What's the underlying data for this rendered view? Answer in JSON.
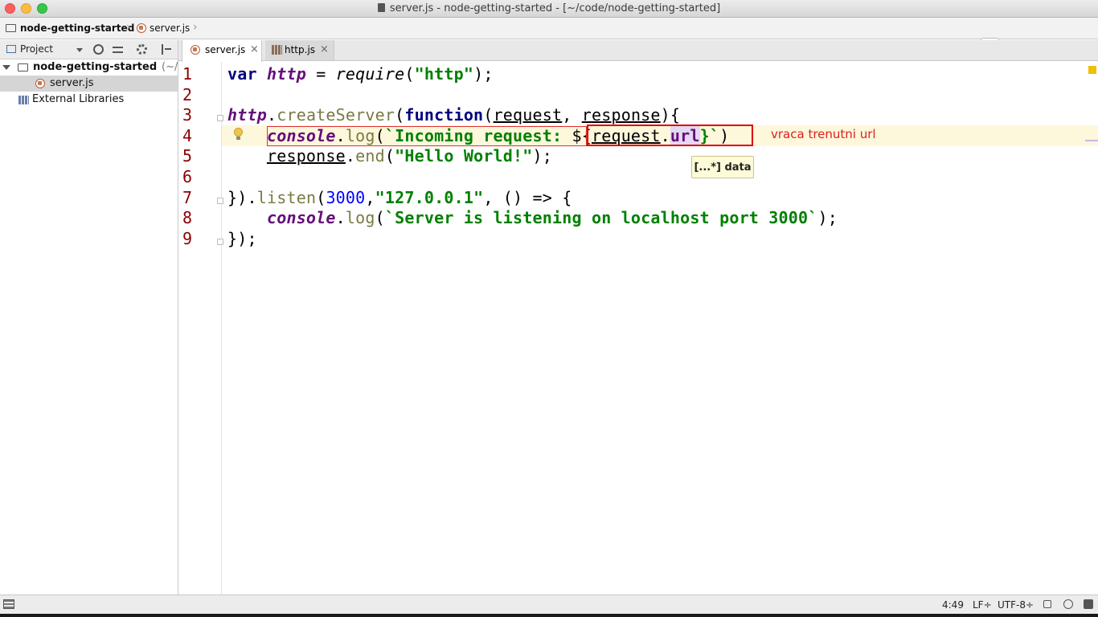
{
  "window": {
    "title": "server.js - node-getting-started - [~/code/node-getting-started]"
  },
  "navbar": {
    "crumb_project": "node-getting-started",
    "crumb_file": "server.js"
  },
  "project_panel": {
    "view_label": "Project",
    "tree": {
      "root_label": "node-getting-started",
      "root_path_hint": "(~/",
      "file_label": "server.js",
      "libraries_label": "External Libraries"
    }
  },
  "editor": {
    "tabs": [
      {
        "label": "server.js",
        "active": true
      },
      {
        "label": "http.js",
        "active": false
      }
    ],
    "line_numbers": [
      "1",
      "2",
      "3",
      "4",
      "5",
      "6",
      "7",
      "8",
      "9"
    ],
    "code": {
      "l1": {
        "kw": "var",
        "var": "http",
        "eq": " = ",
        "fn": "require",
        "open": "(",
        "str": "\"http\"",
        "close": ");"
      },
      "l3": {
        "var": "http",
        "dot": ".",
        "meth": "createServer",
        "open": "(",
        "kw": "function",
        "p_open": "(",
        "p1": "request",
        "comma": ", ",
        "p2": "response",
        "close": "){"
      },
      "l4": {
        "indent": "    ",
        "var": "console",
        "dot": ".",
        "meth": "log",
        "open": "(",
        "tpl": "`Incoming request: ",
        "tpl_open": "${",
        "p": "request",
        "dot2": ".",
        "url": "url",
        "tpl_close": "}`",
        "close": ")"
      },
      "l5": {
        "indent": "    ",
        "p": "response",
        "dot": ".",
        "meth": "end",
        "open": "(",
        "str": "\"Hello World!\"",
        "close": ");"
      },
      "l7": {
        "open": "}).",
        "meth": "listen",
        "p_open": "(",
        "num": "3000",
        "comma": ",",
        "str": "\"127.0.0.1\"",
        "arrow": ", () => {"
      },
      "l8": {
        "indent": "    ",
        "var": "console",
        "dot": ".",
        "meth": "log",
        "open": "(",
        "tpl": "`Server is listening on localhost port 3000`",
        "close": ");"
      },
      "l9": {
        "text": "});"
      }
    },
    "tooltip": "[...*] data",
    "annotation_note": "vraca trenutni url"
  },
  "status_bar": {
    "position": "4:49",
    "line_separator": "LF÷",
    "encoding": "UTF-8÷"
  },
  "colors": {
    "keyword": "#000080",
    "variable": "#660e7a",
    "string": "#008000",
    "number": "#0000ff",
    "annotation": "#e00000"
  }
}
